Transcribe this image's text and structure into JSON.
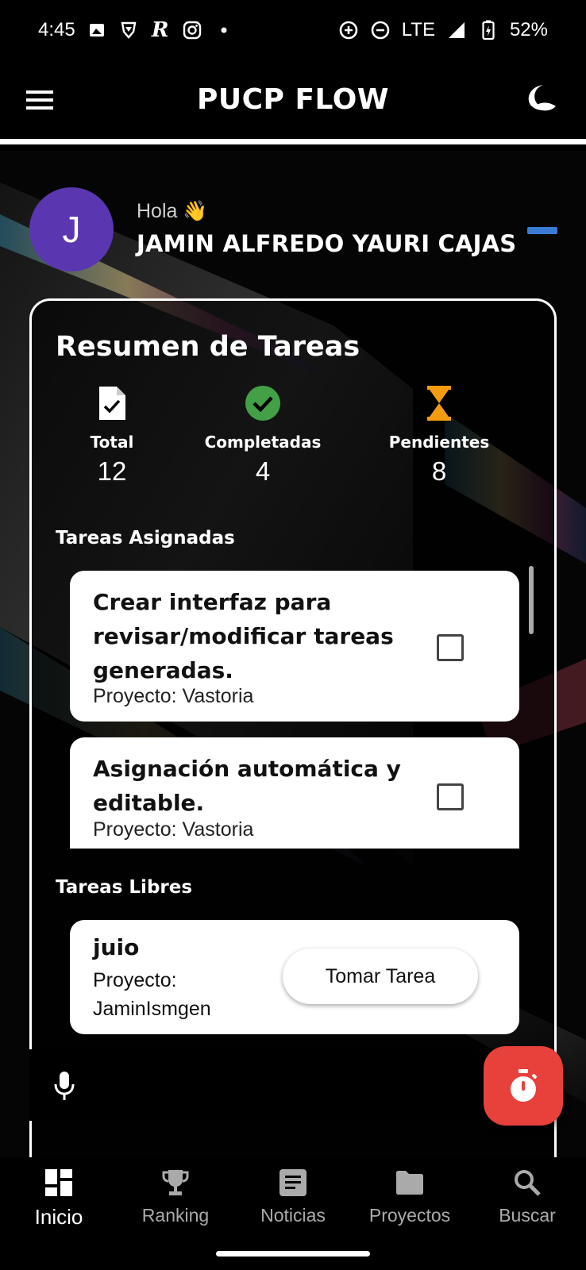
{
  "status": {
    "time": "4:45",
    "network": "LTE",
    "battery": "52%"
  },
  "appbar": {
    "title": "PUCP FLOW"
  },
  "greeting": {
    "avatar_initial": "J",
    "hola": "Hola 👋",
    "name": "JAMIN ALFREDO YAURI CAJAS"
  },
  "summary": {
    "title": "Resumen de Tareas",
    "stats": [
      {
        "label": "Total",
        "value": "12"
      },
      {
        "label": "Completadas",
        "value": "4"
      },
      {
        "label": "Pendientes",
        "value": "8"
      }
    ],
    "colors": {
      "completed": "#43a047",
      "pending": "#f39c12"
    }
  },
  "assigned": {
    "label": "Tareas Asignadas",
    "tasks": [
      {
        "title": " Crear interfaz para revisar/modificar tareas generadas.",
        "project": "Proyecto: Vastoria",
        "checked": false
      },
      {
        "title": " Asignación automática y editable.",
        "project": "Proyecto: Vastoria",
        "checked": false
      }
    ]
  },
  "free": {
    "label": "Tareas Libres",
    "tasks": [
      {
        "title": "juio",
        "project": "Proyecto: JaminIsmgen",
        "action": "Tomar Tarea"
      }
    ]
  },
  "fab": {
    "color": "#e8403a",
    "icon": "timer-icon"
  },
  "nav": {
    "items": [
      {
        "label": "Inicio",
        "icon": "dashboard-icon",
        "active": true
      },
      {
        "label": "Ranking",
        "icon": "trophy-icon",
        "active": false
      },
      {
        "label": "Noticias",
        "icon": "article-icon",
        "active": false
      },
      {
        "label": "Proyectos",
        "icon": "folder-icon",
        "active": false
      },
      {
        "label": "Buscar",
        "icon": "search-icon",
        "active": false
      }
    ]
  }
}
